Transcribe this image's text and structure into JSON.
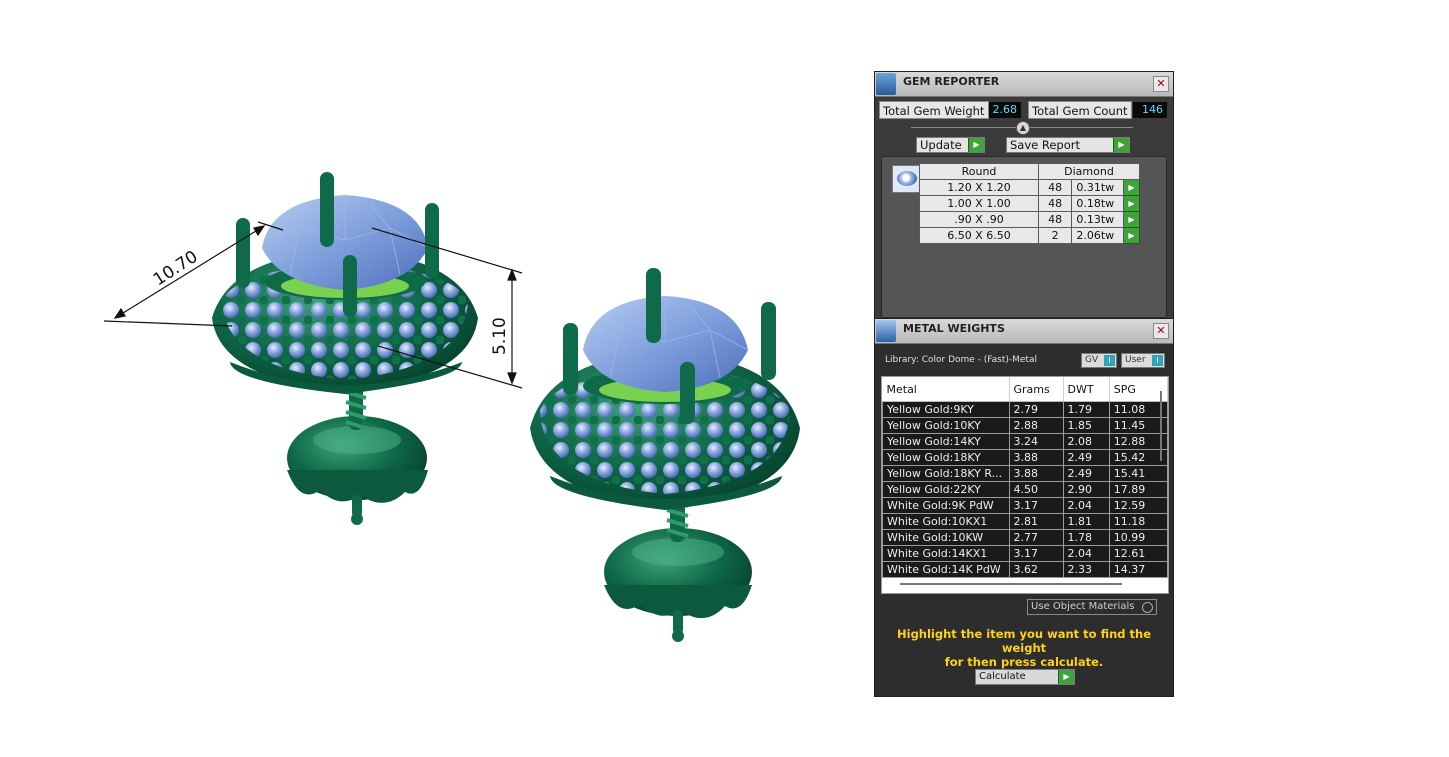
{
  "viewport": {
    "dimension_1": "10.70",
    "dimension_2": "5.10",
    "colors": {
      "metal": "#0f6a4a",
      "stone": "#7f9fdc",
      "background": "#ffffff"
    }
  },
  "gem_reporter": {
    "title": "GEM REPORTER",
    "total_weight_label": "Total Gem Weight",
    "total_weight_value": "2.68",
    "total_count_label": "Total Gem Count",
    "total_count_value": "146",
    "update_label": "Update",
    "save_label": "Save Report",
    "table": {
      "shape": "Round",
      "material": "Diamond",
      "rows": [
        {
          "size": "1.20 X 1.20",
          "count": "48",
          "weight": "0.31tw"
        },
        {
          "size": "1.00 X 1.00",
          "count": "48",
          "weight": "0.18tw"
        },
        {
          "size": ".90 X .90",
          "count": "48",
          "weight": "0.13tw"
        },
        {
          "size": "6.50 X 6.50",
          "count": "2",
          "weight": "2.06tw"
        }
      ]
    }
  },
  "metal_weights": {
    "title": "METAL WEIGHTS",
    "library": "Library: Color Dome - (Fast)-Metal",
    "gv_label": "GV",
    "user_label": "User",
    "columns": [
      "Metal",
      "Grams",
      "DWT",
      "SPG"
    ],
    "rows": [
      {
        "metal": "Yellow Gold:9KY",
        "grams": "2.79",
        "dwt": "1.79",
        "spg": "11.08"
      },
      {
        "metal": "Yellow Gold:10KY",
        "grams": "2.88",
        "dwt": "1.85",
        "spg": "11.45"
      },
      {
        "metal": "Yellow Gold:14KY",
        "grams": "3.24",
        "dwt": "2.08",
        "spg": "12.88"
      },
      {
        "metal": "Yellow Gold:18KY",
        "grams": "3.88",
        "dwt": "2.49",
        "spg": "15.42"
      },
      {
        "metal": "Yellow Gold:18KY R...",
        "grams": "3.88",
        "dwt": "2.49",
        "spg": "15.41"
      },
      {
        "metal": "Yellow Gold:22KY",
        "grams": "4.50",
        "dwt": "2.90",
        "spg": "17.89"
      },
      {
        "metal": "White Gold:9K PdW",
        "grams": "3.17",
        "dwt": "2.04",
        "spg": "12.59"
      },
      {
        "metal": "White Gold:10KX1",
        "grams": "2.81",
        "dwt": "1.81",
        "spg": "11.18"
      },
      {
        "metal": "White Gold:10KW",
        "grams": "2.77",
        "dwt": "1.78",
        "spg": "10.99"
      },
      {
        "metal": "White Gold:14KX1",
        "grams": "3.17",
        "dwt": "2.04",
        "spg": "12.61"
      },
      {
        "metal": "White Gold:14K PdW",
        "grams": "3.62",
        "dwt": "2.33",
        "spg": "14.37"
      }
    ],
    "use_object_materials": "Use Object Materials",
    "hint_line_1": "Highlight the item you want to find the weight",
    "hint_line_2": "for then press calculate.",
    "calculate_label": "Calculate"
  }
}
